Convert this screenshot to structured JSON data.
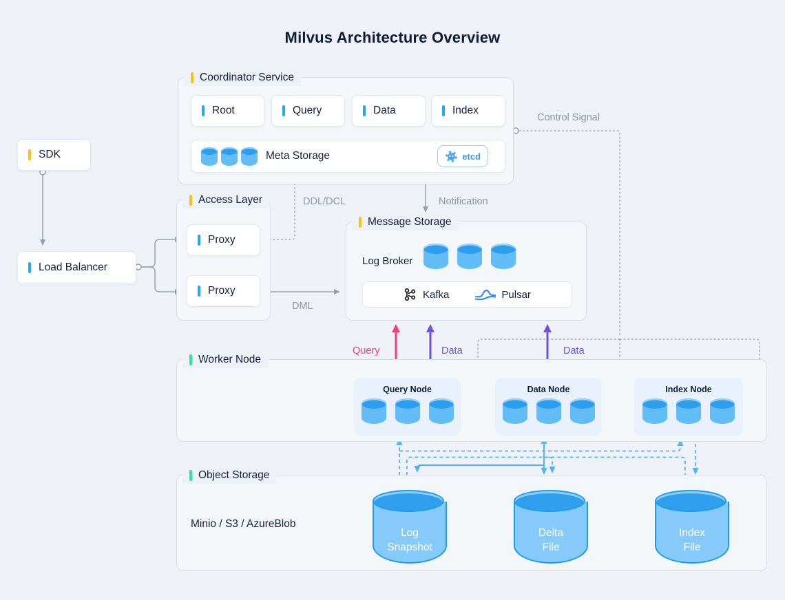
{
  "title": "Milvus Architecture Overview",
  "colors": {
    "background": "#eef2f6",
    "accent_yellow": "#f8c21c",
    "accent_blue": "#27a7f1",
    "accent_green": "#2be3a4",
    "query_arrow": "#ee3f7d",
    "data_arrow": "#6f53d8",
    "storage_line": "#54b4f2",
    "control_line": "#9aa4b1"
  },
  "nodes": {
    "sdk": {
      "label": "SDK"
    },
    "load_balancer": {
      "label": "Load Balancer"
    }
  },
  "coordinator": {
    "label": "Coordinator Service",
    "items": [
      {
        "label": "Root"
      },
      {
        "label": "Query"
      },
      {
        "label": "Data"
      },
      {
        "label": "Index"
      }
    ],
    "meta_storage": {
      "label": "Meta Storage",
      "badge": "etcd"
    }
  },
  "access_layer": {
    "label": "Access Layer",
    "items": [
      {
        "label": "Proxy"
      },
      {
        "label": "Proxy"
      }
    ]
  },
  "message_storage": {
    "label": "Message Storage",
    "log_broker": "Log Broker",
    "brokers": [
      {
        "label": "Kafka"
      },
      {
        "label": "Pulsar"
      }
    ]
  },
  "worker": {
    "label": "Worker Node",
    "nodes": [
      {
        "label": "Query Node"
      },
      {
        "label": "Data Node"
      },
      {
        "label": "Index Node"
      }
    ]
  },
  "object_storage": {
    "label": "Object Storage",
    "providers": "Minio / S3 / AzureBlob",
    "files": [
      {
        "line1": "Log",
        "line2": "Snapshot"
      },
      {
        "line1": "Delta",
        "line2": "File"
      },
      {
        "line1": "Index",
        "line2": "File"
      }
    ]
  },
  "edges": {
    "ddl": "DDL/DCL",
    "dml": "DML",
    "notification": "Notification",
    "control": "Control Signal",
    "query": "Query",
    "data_query_node": "Data",
    "data_data_node": "Data"
  }
}
